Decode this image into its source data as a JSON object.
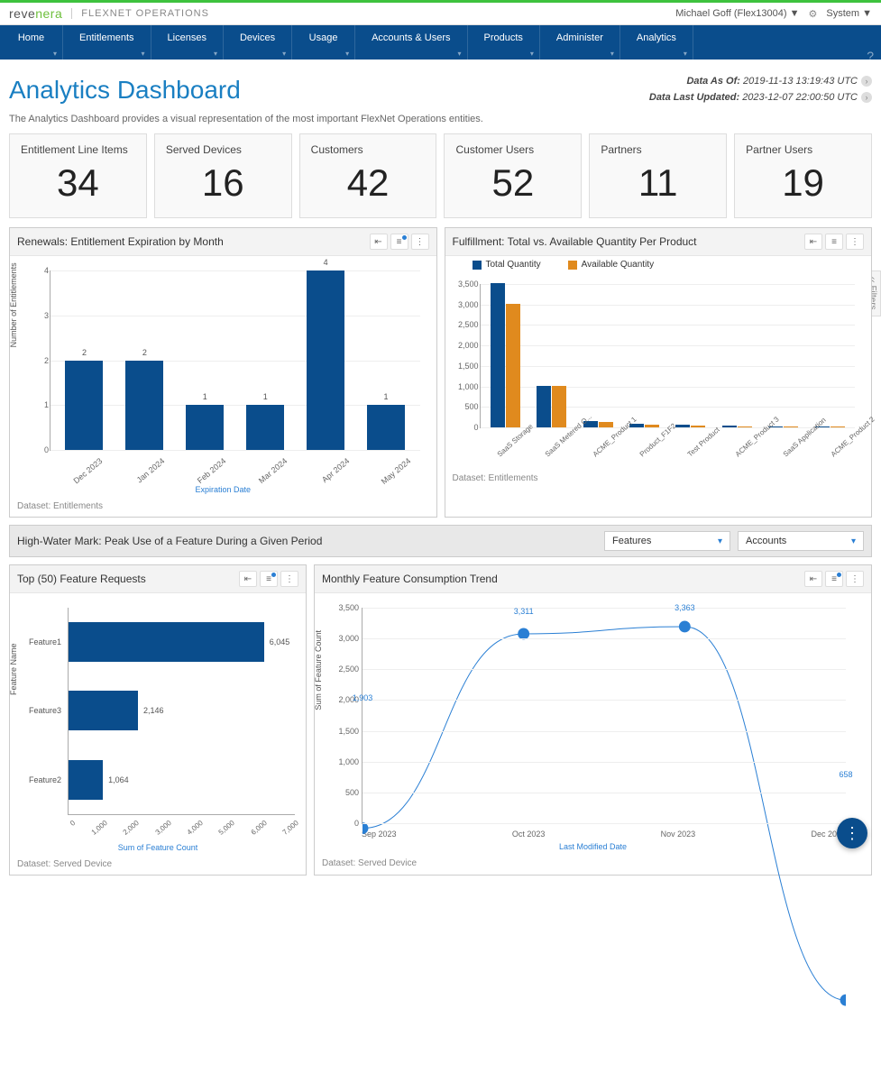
{
  "brand": {
    "logo_prefix": "reve",
    "logo_suffix": "nera",
    "app": "FLEXNET OPERATIONS"
  },
  "user": {
    "name": "Michael Goff (Flex13004) ▼",
    "system": "System ▼"
  },
  "nav": [
    "Home",
    "Entitlements",
    "Licenses",
    "Devices",
    "Usage",
    "Accounts & Users",
    "Products",
    "Administer",
    "Analytics"
  ],
  "page": {
    "title": "Analytics Dashboard",
    "desc": "The Analytics Dashboard provides a visual representation of the most important FlexNet Operations entities.",
    "data_as_of_lbl": "Data As Of:",
    "data_as_of": "2019-11-13 13:19:43 UTC",
    "data_updated_lbl": "Data Last Updated:",
    "data_updated": "2023-12-07 22:00:50 UTC"
  },
  "kpis": [
    {
      "title": "Entitlement Line Items",
      "value": "34"
    },
    {
      "title": "Served Devices",
      "value": "16"
    },
    {
      "title": "Customers",
      "value": "42"
    },
    {
      "title": "Customer Users",
      "value": "52"
    },
    {
      "title": "Partners",
      "value": "11"
    },
    {
      "title": "Partner Users",
      "value": "19"
    }
  ],
  "renewals": {
    "title": "Renewals: Entitlement Expiration by Month",
    "dataset": "Dataset: Entitlements",
    "ylabel": "Number of Entitlements",
    "xlabel": "Expiration Date"
  },
  "fulfillment": {
    "title": "Fulfillment: Total vs. Available Quantity Per Product",
    "dataset": "Dataset: Entitlements",
    "legend_total": "Total Quantity",
    "legend_avail": "Available Quantity"
  },
  "hw": {
    "title": "High-Water Mark: Peak Use of a Feature During a Given Period",
    "sel1": "Features",
    "sel2": "Accounts"
  },
  "top50": {
    "title": "Top (50) Feature Requests",
    "dataset": "Dataset: Served Device",
    "ylabel": "Feature Name",
    "xlabel": "Sum of Feature Count"
  },
  "trend": {
    "title": "Monthly Feature Consumption Trend",
    "dataset": "Dataset: Served Device",
    "ylabel": "Sum of Feature Count",
    "xlabel": "Last Modified Date"
  },
  "filters_tab": "‹‹  Filters",
  "chart_data": [
    {
      "id": "renewals",
      "type": "bar",
      "categories": [
        "Dec 2023",
        "Jan 2024",
        "Feb 2024",
        "Mar 2024",
        "Apr 2024",
        "May 2024"
      ],
      "values": [
        2,
        2,
        1,
        1,
        4,
        1
      ],
      "ylim": [
        0,
        4
      ],
      "xlabel": "Expiration Date",
      "ylabel": "Number of Entitlements"
    },
    {
      "id": "fulfillment",
      "type": "bar",
      "categories": [
        "SaaS Storage",
        "SaaS Metered O...",
        "ACME_Product 1",
        "Product_F1F2",
        "Test Product",
        "ACME_Product 3",
        "SaaS Application",
        "ACME_Product 2"
      ],
      "series": [
        {
          "name": "Total Quantity",
          "color": "#0a4d8c",
          "values": [
            3500,
            1000,
            150,
            80,
            60,
            40,
            30,
            20
          ]
        },
        {
          "name": "Available Quantity",
          "color": "#e08a1e",
          "values": [
            3000,
            1000,
            130,
            60,
            50,
            30,
            25,
            15
          ]
        }
      ],
      "ylim": [
        0,
        3500
      ]
    },
    {
      "id": "top50",
      "type": "bar",
      "orientation": "horizontal",
      "categories": [
        "Feature1",
        "Feature3",
        "Feature2"
      ],
      "values": [
        6045,
        2146,
        1064
      ],
      "xlim": [
        0,
        7000
      ],
      "xlabel": "Sum of Feature Count",
      "ylabel": "Feature Name"
    },
    {
      "id": "trend",
      "type": "line",
      "x": [
        "Sep 2023",
        "Oct 2023",
        "Nov 2023",
        "Dec 2023"
      ],
      "values": [
        1903,
        3311,
        3363,
        658
      ],
      "ylim": [
        0,
        3500
      ],
      "xlabel": "Last Modified Date",
      "ylabel": "Sum of Feature Count"
    }
  ]
}
